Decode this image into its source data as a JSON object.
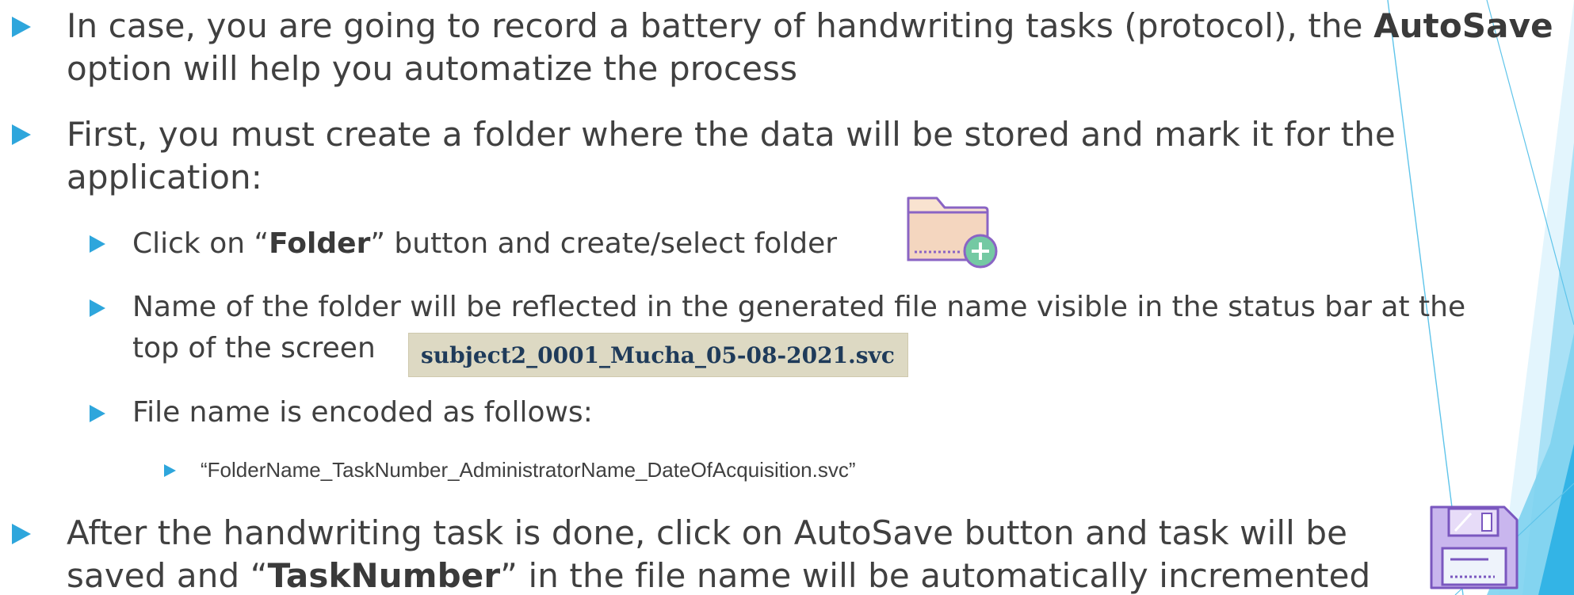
{
  "bullets": {
    "autosave_intro": {
      "part1": "In case, you are going to record a battery of handwriting tasks (protocol), the ",
      "bold": "AutoSave",
      "part2": "option will help you automatize the process"
    },
    "create_folder": {
      "line1": "First, you must create a folder where the data will be stored and mark it for the",
      "line2": "application:"
    },
    "click_folder": {
      "pre": "Click on “",
      "bold": "Folder",
      "post": "” button and create/select folder"
    },
    "folder_name": {
      "line1": "Name of the folder will be reflected in the generated file name visible in the status bar at the",
      "line2": "top of the screen"
    },
    "example_filename": "subject2_0001_Mucha_05-08-2021.svc",
    "encoding": "File name is encoded as follows:",
    "format": "“FolderName_TaskNumber_AdministratorName_DateOfAcquisition.svc”",
    "after_task": {
      "line1": "After the handwriting task is done, click on AutoSave button and task will be",
      "pre": "saved and “",
      "bold": "TaskNumber",
      "post": "” in the file name will be automatically incremented"
    }
  },
  "icons": {
    "folder": "folder-add-icon",
    "save": "floppy-disk-icon"
  },
  "colors": {
    "bullet": "#2ea6dc",
    "text": "#404040",
    "filename_bg": "#ddd9c3",
    "accent": "#7ed3f0"
  }
}
